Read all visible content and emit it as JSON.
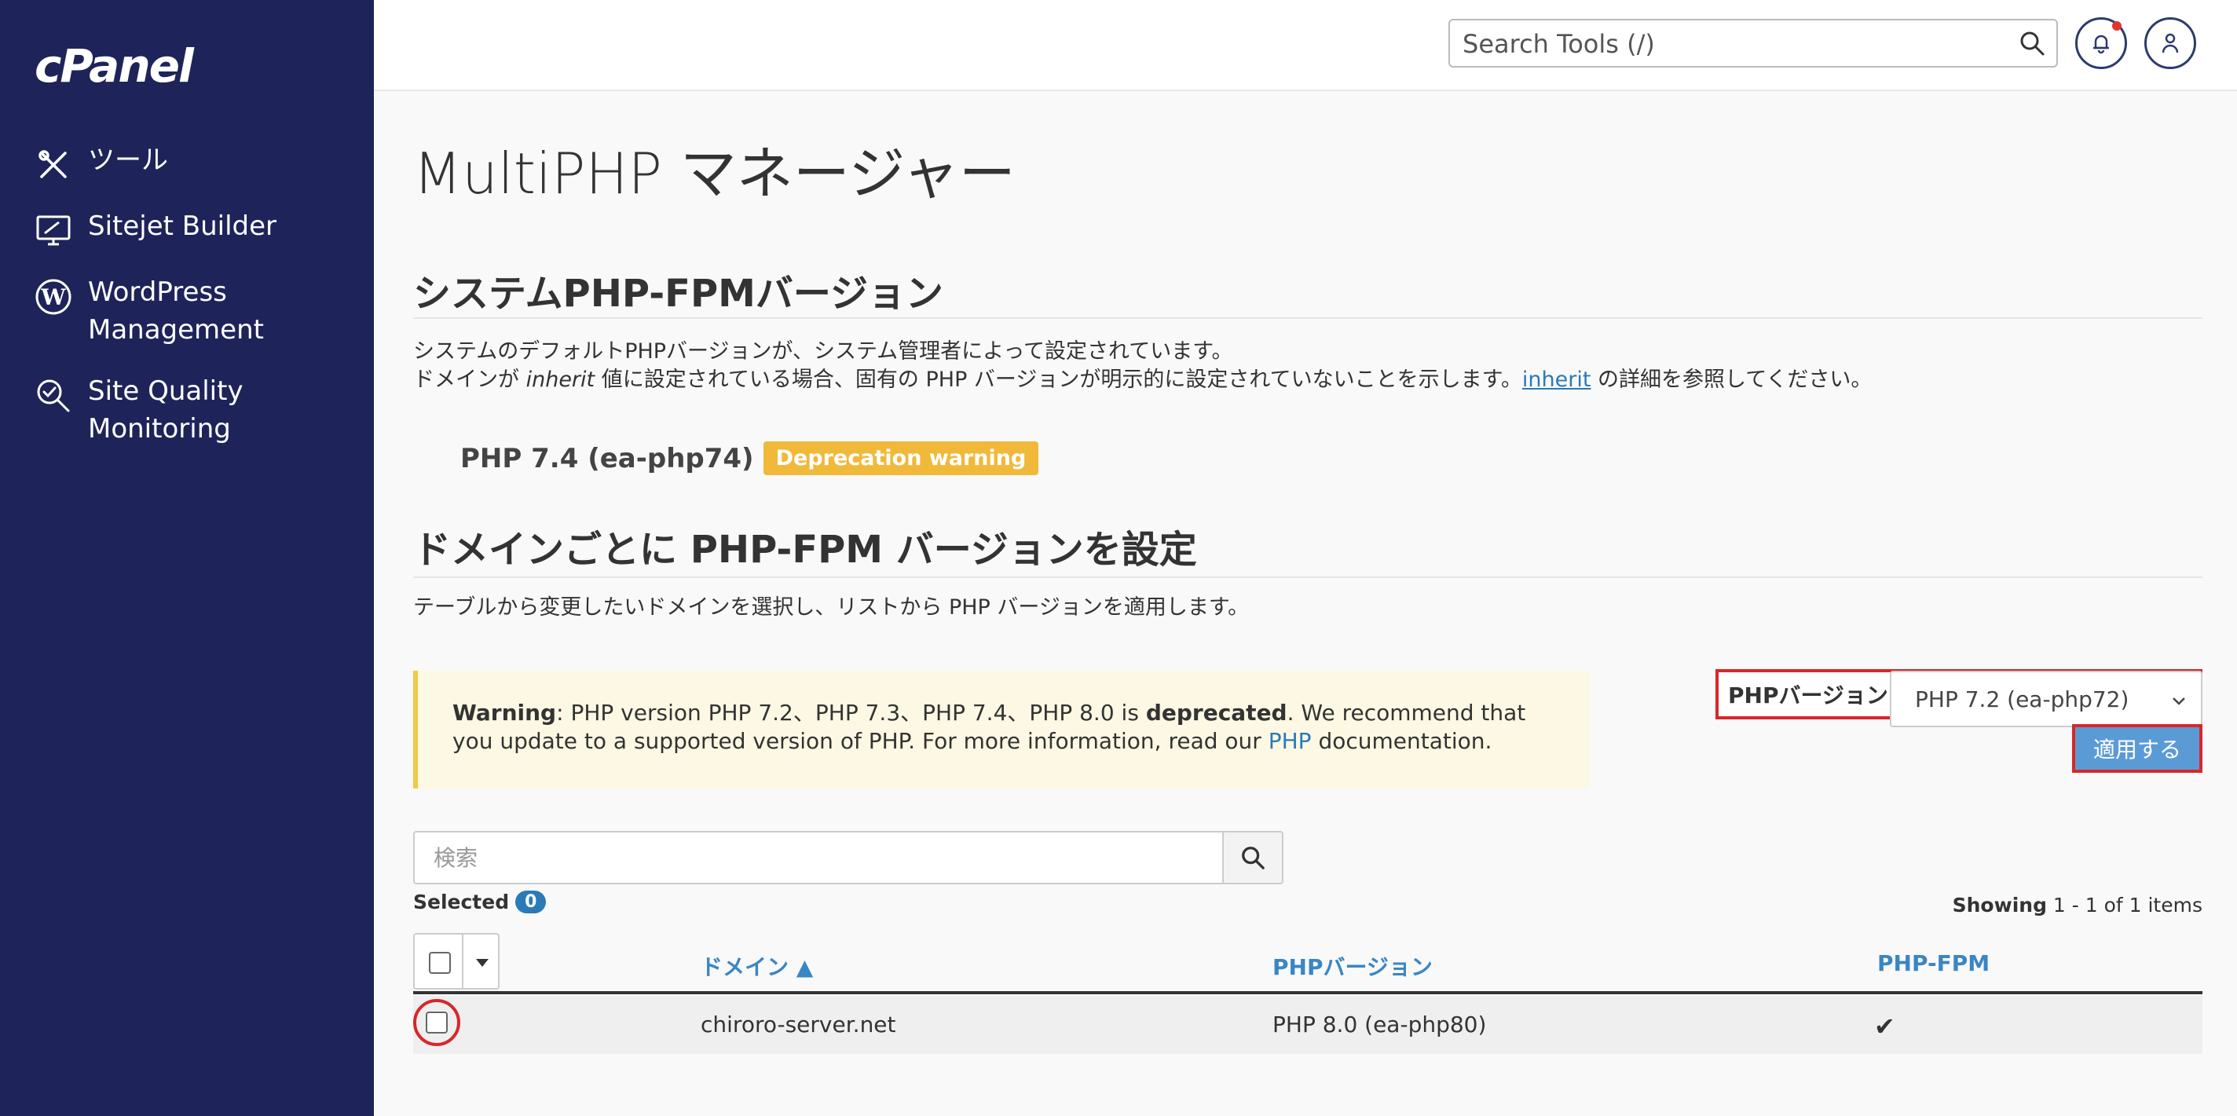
{
  "sidebar": {
    "logo": "cPanel",
    "items": [
      {
        "label": "ツール",
        "icon": "tools-icon"
      },
      {
        "label": "Sitejet Builder",
        "icon": "sitejet-icon"
      },
      {
        "label": "WordPress\nManagement",
        "icon": "wordpress-icon"
      },
      {
        "label": "Site Quality\nMonitoring",
        "icon": "site-quality-icon"
      }
    ]
  },
  "header": {
    "search_placeholder": "Search Tools (/)"
  },
  "page": {
    "title": "MultiPHP マネージャー",
    "system_section_title": "システムPHP-FPMバージョン",
    "system_para_1": "システムのデフォルトPHPバージョンが、システム管理者によって設定されています。",
    "system_para_2_a": "ドメインが ",
    "system_para_2_em": "inherit",
    "system_para_2_b": " 値に設定されている場合、固有の PHP バージョンが明示的に設定されていないことを示します。",
    "system_para_2_link": "inherit",
    "system_para_2_c": " の詳細を参照してください。",
    "system_version": "PHP 7.4 (ea-php74)",
    "deprecation_badge": "Deprecation warning",
    "domain_section_title": "ドメインごとに PHP-FPM バージョンを設定",
    "domain_para": "テーブルから変更したいドメインを選択し、リストから PHP バージョンを適用します。"
  },
  "warning": {
    "label": "Warning",
    "text_1": ": PHP version PHP 7.2、PHP 7.3、PHP 7.4、PHP 8.0 is ",
    "deprecated": "deprecated",
    "text_2": ". We recommend that you update to a supported version of PHP. For more information, read our ",
    "link": "PHP",
    "text_3": " documentation."
  },
  "php_selector": {
    "label": "PHPバージョン",
    "selected": "PHP 7.2 (ea-php72)",
    "apply": "適用する"
  },
  "table": {
    "search_placeholder": "検索",
    "selected_label": "Selected",
    "selected_count": "0",
    "showing_label": "Showing",
    "showing_text": " 1 - 1 of 1 items",
    "columns": {
      "domain": "ドメイン ▲",
      "php_version": "PHPバージョン",
      "php_fpm": "PHP-FPM"
    },
    "rows": [
      {
        "domain": "chiroro-server.net",
        "php_version": "PHP 8.0 (ea-php80)",
        "php_fpm": "✔"
      }
    ]
  }
}
